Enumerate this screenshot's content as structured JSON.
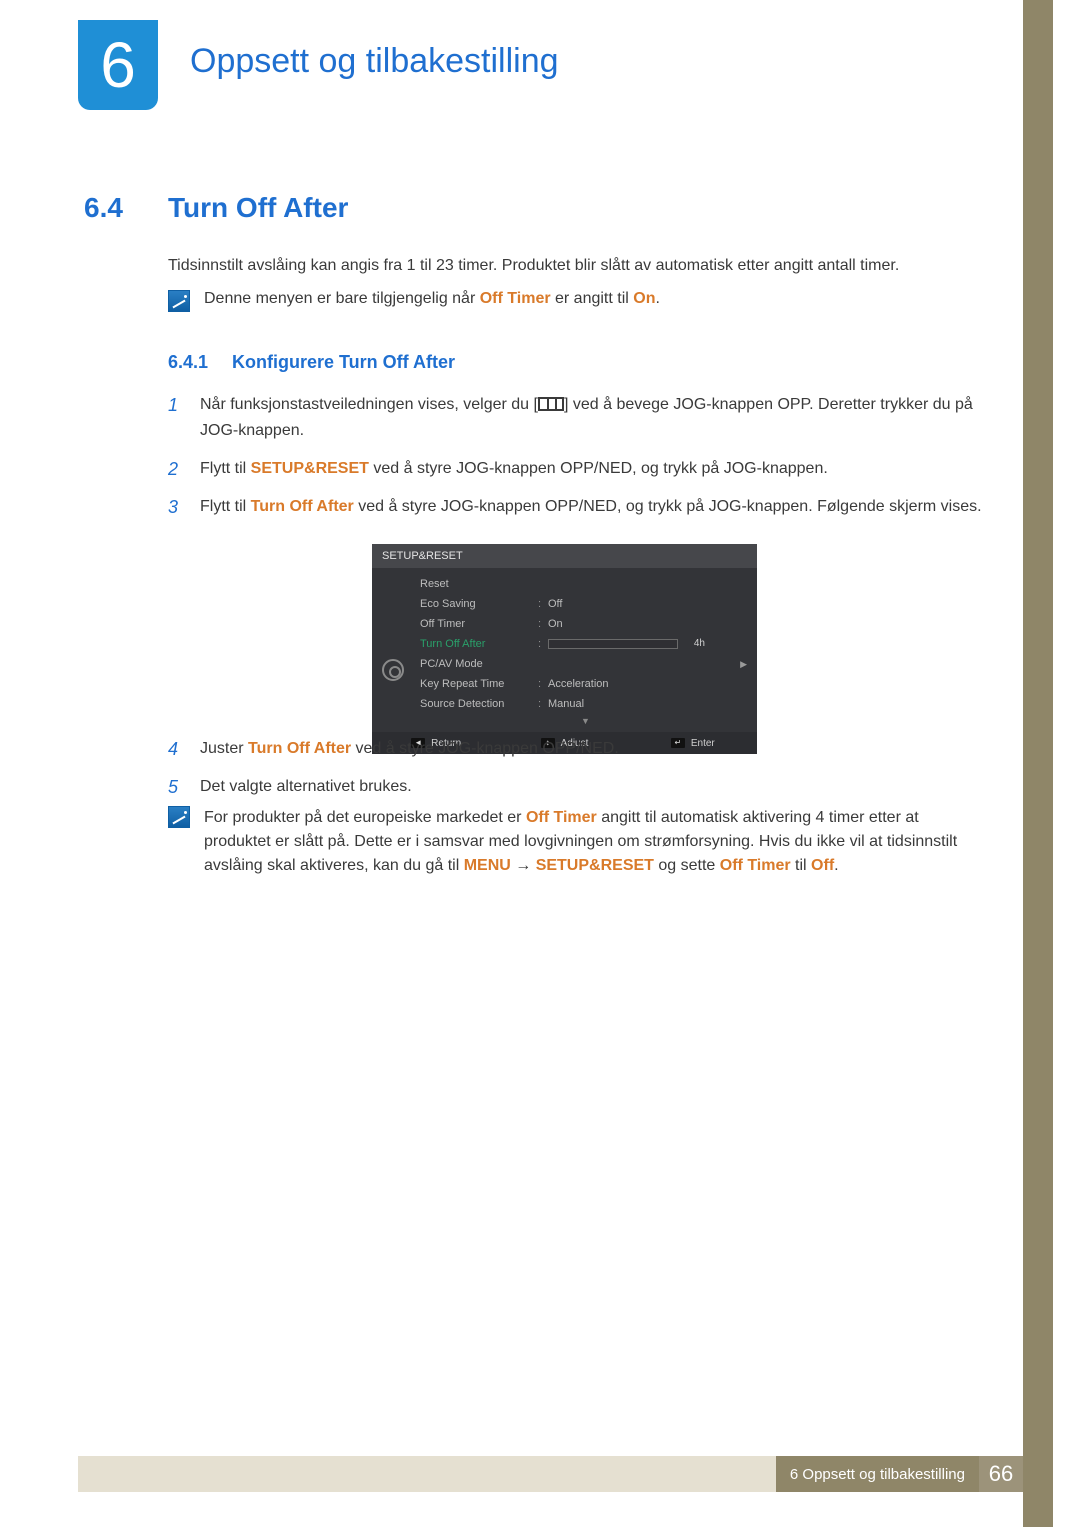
{
  "chapter": {
    "num": "6",
    "title": "Oppsett og tilbakestilling"
  },
  "section": {
    "num": "6.4",
    "title": "Turn Off After"
  },
  "intro": "Tidsinnstilt avslåing kan angis fra 1 til 23 timer. Produktet blir slått av automatisk etter angitt antall timer.",
  "note1": {
    "pre": "Denne menyen er bare tilgjengelig når ",
    "k1": "Off Timer",
    "mid": " er angitt til ",
    "k2": "On",
    "post": "."
  },
  "subsection": {
    "num": "6.4.1",
    "title": "Konfigurere Turn Off After"
  },
  "steps": {
    "s1": {
      "n": "1",
      "a": "Når funksjonstastveiledningen vises, velger du [",
      "b": "] ved å bevege JOG-knappen OPP. Deretter trykker du på JOG-knappen."
    },
    "s2": {
      "n": "2",
      "a": "Flytt til ",
      "k": "SETUP&RESET",
      "b": " ved å styre JOG-knappen OPP/NED, og trykk på JOG-knappen."
    },
    "s3": {
      "n": "3",
      "a": "Flytt til ",
      "k": "Turn Off After",
      "b": " ved å styre JOG-knappen OPP/NED, og trykk på JOG-knappen. Følgende skjerm vises."
    },
    "s4": {
      "n": "4",
      "a": "Juster ",
      "k": "Turn Off After",
      "b": " ved å styre JOG-knappen OPP/NED."
    },
    "s5": {
      "n": "5",
      "a": "Det valgte alternativet brukes."
    }
  },
  "osd": {
    "title": "SETUP&RESET",
    "rows": [
      {
        "label": "Reset",
        "val": ""
      },
      {
        "label": "Eco Saving",
        "val": "Off"
      },
      {
        "label": "Off Timer",
        "val": "On"
      },
      {
        "label": "Turn Off After",
        "val": "4h",
        "active": true,
        "slider": 17
      },
      {
        "label": "PC/AV Mode",
        "val": "",
        "arrow": true
      },
      {
        "label": "Key Repeat Time",
        "val": "Acceleration"
      },
      {
        "label": "Source Detection",
        "val": "Manual"
      }
    ],
    "footer": {
      "return": "Return",
      "adjust": "Adjust",
      "enter": "Enter"
    }
  },
  "note2": {
    "a": "For produkter på det europeiske markedet er ",
    "k1": "Off Timer",
    "b": " angitt til automatisk aktivering 4 timer etter at produktet er slått på. Dette er i samsvar med lovgivningen om strømforsyning. Hvis du ikke vil at tidsinnstilt avslåing skal aktiveres, kan du gå til ",
    "k2": "MENU",
    "arr": " → ",
    "k3": "SETUP&RESET",
    "c": " og sette ",
    "k4": "Off Timer",
    "d": " til ",
    "k5": "Off",
    "e": "."
  },
  "footer": {
    "chapter": "6 Oppsett og tilbakestilling",
    "page": "66"
  }
}
